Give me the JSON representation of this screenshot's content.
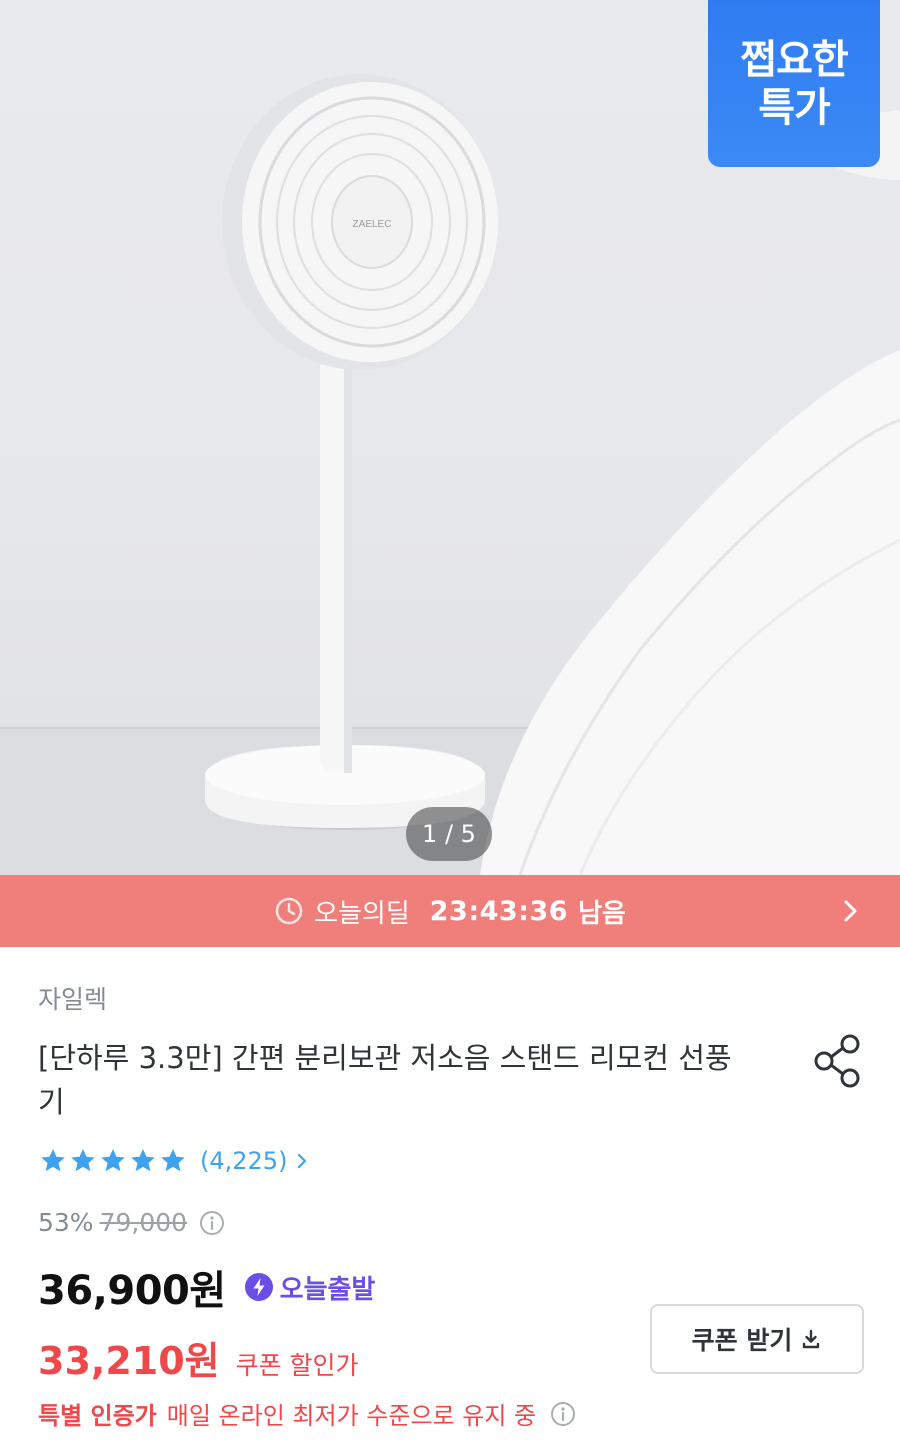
{
  "hero": {
    "image_alt_icon": "standing-fan-photo",
    "fan_brand_mark": "ZAELEC",
    "badge_line1": "쩝요한",
    "badge_line2": "특가",
    "counter": "1 / 5"
  },
  "deal_bar": {
    "label": "오늘의딜",
    "timer": "23:43:36",
    "remain": "남음",
    "icon": "clock-icon",
    "color": "#f07f7c"
  },
  "product": {
    "brand": "자일렉",
    "title": "[단하루 3.3만] 간편 분리보관 저소음 스탠드 리모컨 선풍기",
    "rating_stars": 5,
    "review_count": "(4,225)",
    "discount_percent": "53%",
    "original_price": "79,000",
    "price": "36,900원",
    "today_ship_label": "오늘출발",
    "coupon_price": "33,210원",
    "coupon_price_label": "쿠폰 할인가",
    "coupon_button": "쿠폰 받기",
    "cert_label": "특별 인증가",
    "cert_text": "매일 온라인 최저가 수준으로 유지 중"
  },
  "colors": {
    "badge_blue": "#3b8af5",
    "rating_blue": "#3ea2ef",
    "sale_red": "#f0484a",
    "today_purple": "#6a4ee8"
  }
}
